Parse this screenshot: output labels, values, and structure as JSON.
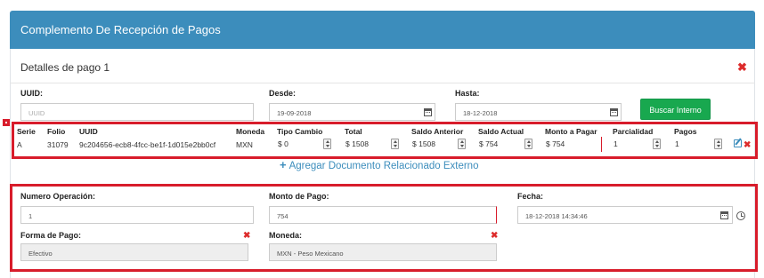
{
  "panel": {
    "title": "Complemento De Recepción de Pagos"
  },
  "detalle": {
    "title": "Detalles de pago 1",
    "uuid_label": "UUID:",
    "uuid_placeholder": "UUID",
    "desde_label": "Desde:",
    "desde_value": "19-09-2018",
    "hasta_label": "Hasta:",
    "hasta_value": "18-12-2018",
    "buscar_button": "Buscar Interno"
  },
  "table": {
    "headers": [
      "Serie",
      "Folio",
      "UUID",
      "Moneda",
      "Tipo Cambio",
      "Total",
      "Saldo Anterior",
      "Saldo Actual",
      "Monto a Pagar",
      "Parcialidad",
      "Pagos"
    ],
    "row": {
      "serie": "A",
      "folio": "31079",
      "uuid": "9c204656-ecb8-4fcc-be1f-1d015e2bb0cf",
      "moneda": "MXN",
      "tipo_cambio": "$ 0",
      "total": "$ 1508",
      "saldo_anterior": "$ 1508",
      "saldo_actual": "$ 754",
      "monto_a_pagar": "$ 754",
      "parcialidad": "1",
      "pagos": "1"
    }
  },
  "add_link": "Agregar Documento Relacionado Externo",
  "pago": {
    "numero_operacion_label": "Numero Operación:",
    "numero_operacion_value": "1",
    "monto_label": "Monto de Pago:",
    "monto_value": "754",
    "fecha_label": "Fecha:",
    "fecha_value": "18-12-2018 14:34:46",
    "forma_label": "Forma de Pago:",
    "forma_value": "Efectivo",
    "moneda_label": "Moneda:",
    "moneda_value": "MXN - Peso Mexicano"
  },
  "colors": {
    "header": "#3c8dbc",
    "button": "#18a84f",
    "highlight": "#d81c2b",
    "close": "#dd2c2c"
  },
  "icons": [
    "calendar-icon",
    "clock-icon",
    "close-icon",
    "edit-icon",
    "plus-icon",
    "spinner-icon"
  ]
}
